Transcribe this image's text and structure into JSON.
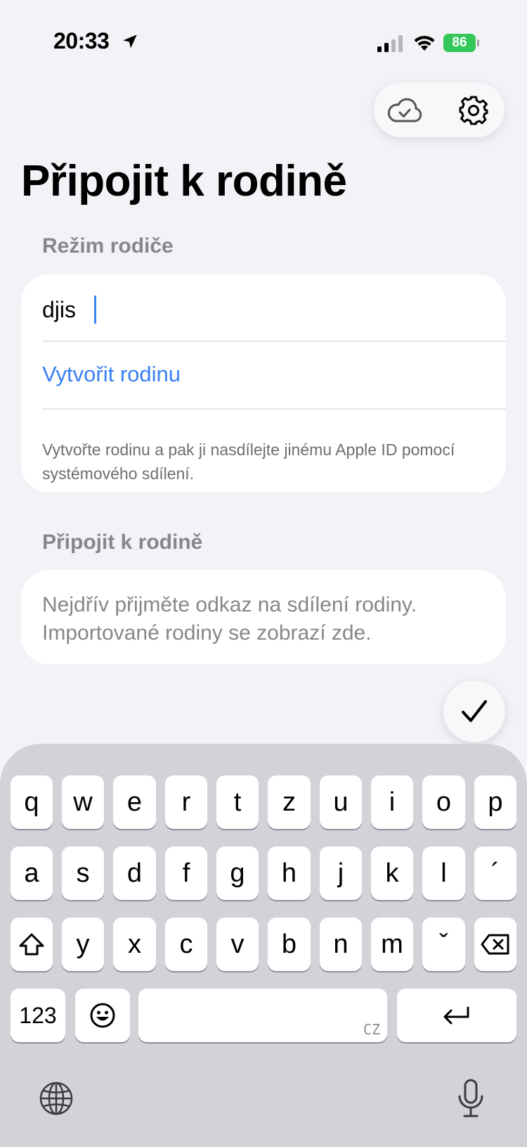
{
  "status_bar": {
    "time": "20:33",
    "battery_percent": "86",
    "icons": [
      "location-arrow-icon",
      "cellular-signal-icon",
      "wifi-icon",
      "battery-icon"
    ]
  },
  "toolbar": {
    "icons": [
      "cloud-check-icon",
      "gear-icon"
    ]
  },
  "page": {
    "title": "Připojit k rodině"
  },
  "parent_section": {
    "header": "Režim rodiče",
    "input_value": "djis",
    "create_link": "Vytvořit rodinu",
    "helper": "Vytvořte rodinu a pak ji nasdílejte jinému Apple ID pomocí systémového sdílení."
  },
  "join_section": {
    "header": "Připojit k rodině",
    "empty_message": "Nejdřív přijměte odkaz na sdílení rodiny. Importované rodiny se zobrazí zde."
  },
  "keyboard": {
    "row1": [
      "q",
      "w",
      "e",
      "r",
      "t",
      "z",
      "u",
      "i",
      "o",
      "p"
    ],
    "row2": [
      "a",
      "s",
      "d",
      "f",
      "g",
      "h",
      "j",
      "k",
      "l",
      "´"
    ],
    "row3": [
      "y",
      "x",
      "c",
      "v",
      "b",
      "n",
      "m",
      "ˇ"
    ],
    "numbers_label": "123",
    "space_lang": "CZ",
    "colors": {
      "background": "#d1d3d9",
      "key": "#ffffff"
    }
  },
  "colors": {
    "accent": "#3a80f3",
    "battery": "#34c759",
    "background": "#f2f2f7"
  }
}
